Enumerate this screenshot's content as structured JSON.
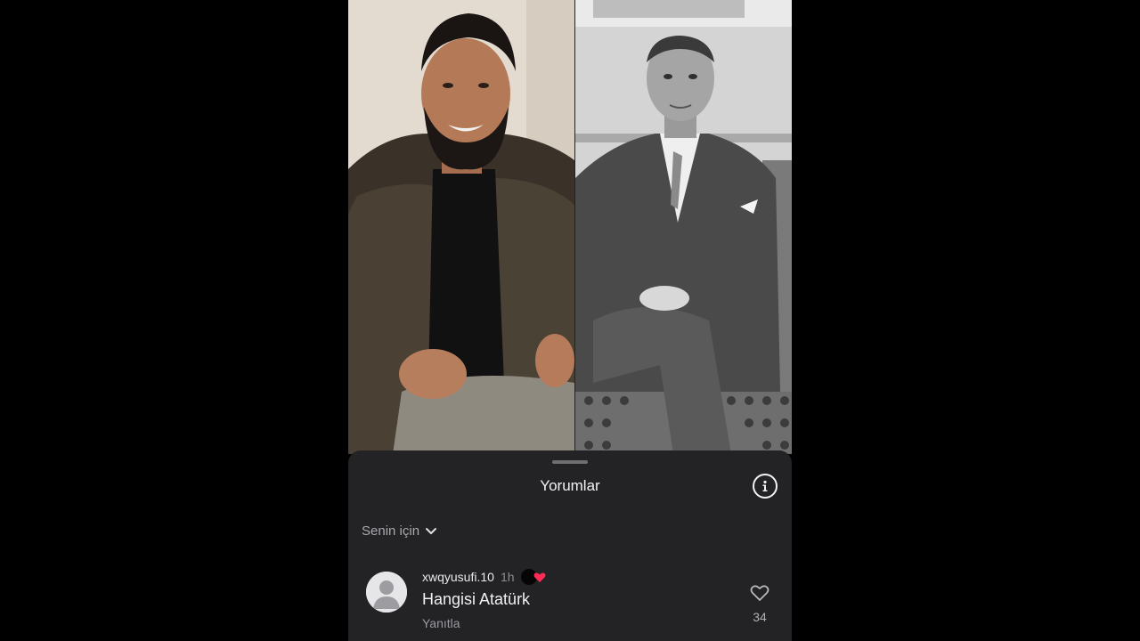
{
  "sheet": {
    "title": "Yorumlar",
    "sort_label": "Senin için"
  },
  "comment": {
    "username": "xwqyusufi.10",
    "time": "1h",
    "text": "Hangisi Atatürk",
    "reply_label": "Yanıtla",
    "like_count": "34"
  },
  "icons": {
    "info": "info-icon",
    "chevron": "chevron-down-icon",
    "heart": "heart-outline-icon",
    "creator_liked": "creator-liked-badge"
  },
  "colors": {
    "sheet_bg": "#232326",
    "accent_red": "#fe2c55"
  }
}
